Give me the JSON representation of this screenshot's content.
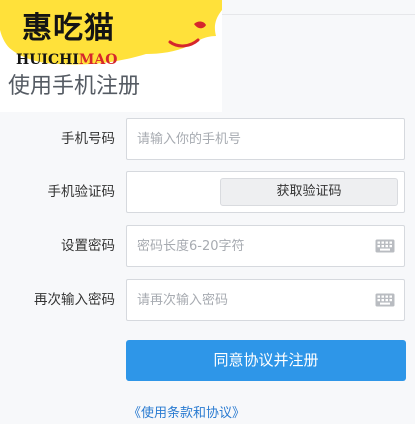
{
  "logo": {
    "chinese": "惠吃猫",
    "latin_dark": "HUICHI",
    "latin_red": "MAO"
  },
  "page_title": "使用手机注册",
  "form": {
    "phone": {
      "label": "手机号码",
      "placeholder": "请输入你的手机号"
    },
    "code": {
      "label": "手机验证码",
      "button": "获取验证码"
    },
    "password": {
      "label": "设置密码",
      "placeholder": "密码长度6-20字符",
      "icon": "keyboard-icon"
    },
    "confirm": {
      "label": "再次输入密码",
      "placeholder": "请再次输入密码",
      "icon": "keyboard-icon"
    }
  },
  "submit_label": "同意协议并注册",
  "terms_link": "《使用条款和协议》",
  "colors": {
    "accent": "#2e96e8",
    "link": "#2a7bd1",
    "logo_yellow": "#ffe13a",
    "logo_red": "#d6262c"
  }
}
